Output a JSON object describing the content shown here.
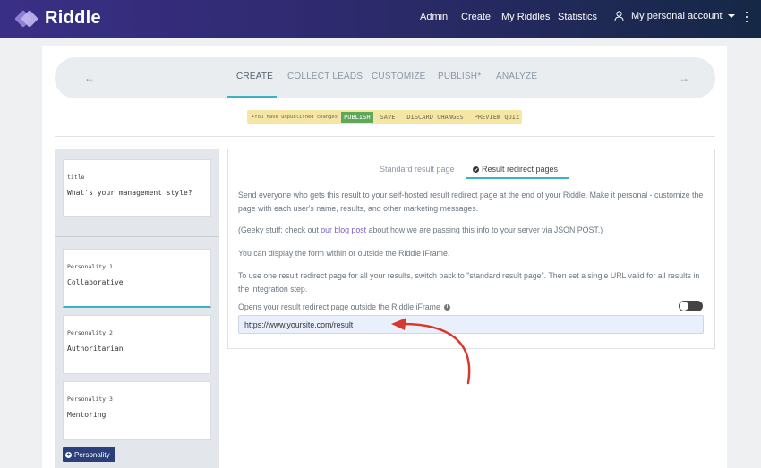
{
  "brand": {
    "name": "Riddle"
  },
  "nav": {
    "admin": "Admin",
    "create": "Create",
    "my_riddles": "My Riddles",
    "statistics": "Statistics",
    "account": "My personal account"
  },
  "steps": {
    "prev_arrow": "←",
    "next_arrow": "→",
    "items": [
      "CREATE",
      "COLLECT LEADS",
      "CUSTOMIZE",
      "PUBLISH*",
      "ANALYZE"
    ]
  },
  "unpublished": {
    "message": "•You have unpublished changes",
    "publish": "PUBLISH",
    "save": "SAVE",
    "discard": "DISCARD CHANGES",
    "preview": "PREVIEW QUIZ"
  },
  "sidebar": {
    "title_tile": {
      "label": "title",
      "value": "What's your management style?"
    },
    "personalities": [
      {
        "label": "Personality 1",
        "value": "Collaborative"
      },
      {
        "label": "Personality 2",
        "value": "Authoritarian"
      },
      {
        "label": "Personality 3",
        "value": "Mentoring"
      }
    ],
    "add_button": "Personality"
  },
  "result_tabs": {
    "standard": "Standard result page",
    "redirect": "Result redirect pages"
  },
  "content": {
    "p1": "Send everyone who gets this result to your self-hosted result redirect page at the end of your Riddle. Make it personal - customize the page with each user's name, results, and other marketing messages.",
    "p2_before": "(Geeky stuff: check out ",
    "p2_link": "our blog post",
    "p2_after": " about how we are passing this info to your server via JSON POST.)",
    "p3": "You can display the form within or outside the Riddle iFrame.",
    "p4": "To use one result redirect page for all your results, switch back to \"standard result page\". Then set a single URL valid for all results in the integration step.",
    "toggle_label": "Opens your result redirect page outside the Riddle iFrame",
    "url_value": "https://www.yoursite.com/result"
  },
  "colors": {
    "accent": "#3cb1c6",
    "publish": "#5fa85a",
    "annotation_arrow": "#d63a2f"
  }
}
